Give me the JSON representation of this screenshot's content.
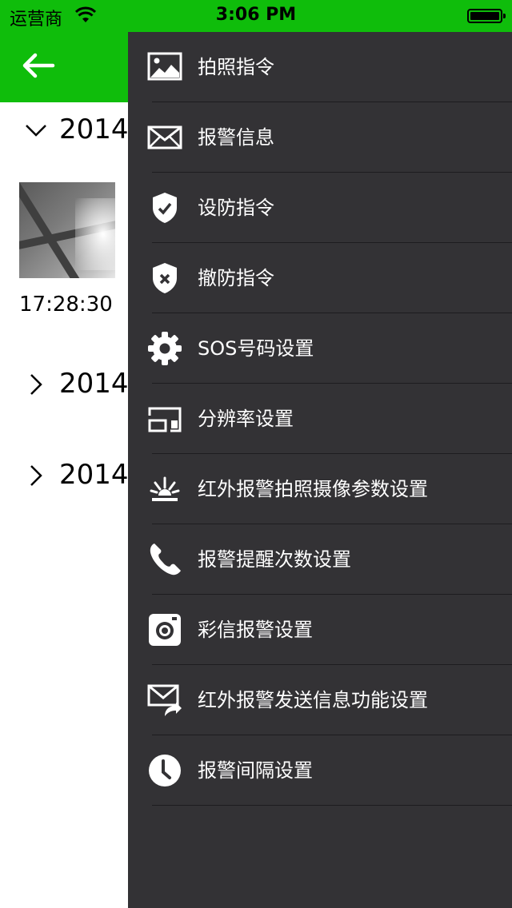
{
  "status_bar": {
    "carrier": "运营商",
    "time": "3:06 PM"
  },
  "nav": {
    "back_icon": "arrow-left-icon"
  },
  "groups": [
    {
      "date": "2014-",
      "expanded": true,
      "photo_time": "17:28:30"
    },
    {
      "date": "2014-",
      "expanded": false
    },
    {
      "date": "2014-",
      "expanded": false
    }
  ],
  "menu": {
    "items": [
      {
        "label": "拍照指令",
        "icon": "image-icon"
      },
      {
        "label": "报警信息",
        "icon": "envelope-icon"
      },
      {
        "label": "设防指令",
        "icon": "shield-check-icon"
      },
      {
        "label": "撤防指令",
        "icon": "shield-x-icon"
      },
      {
        "label": "SOS号码设置",
        "icon": "gear-icon"
      },
      {
        "label": "分辨率设置",
        "icon": "resolution-icon"
      },
      {
        "label": "红外报警拍照摄像参数设置",
        "icon": "infrared-icon"
      },
      {
        "label": "报警提醒次数设置",
        "icon": "phone-icon"
      },
      {
        "label": "彩信报警设置",
        "icon": "camera-icon"
      },
      {
        "label": "红外报警发送信息功能设置",
        "icon": "mail-forward-icon"
      },
      {
        "label": "报警间隔设置",
        "icon": "clock-icon"
      }
    ]
  },
  "colors": {
    "accent": "#0fbd0b",
    "drawer_bg": "#333235",
    "separator": "#1d1c1f"
  }
}
